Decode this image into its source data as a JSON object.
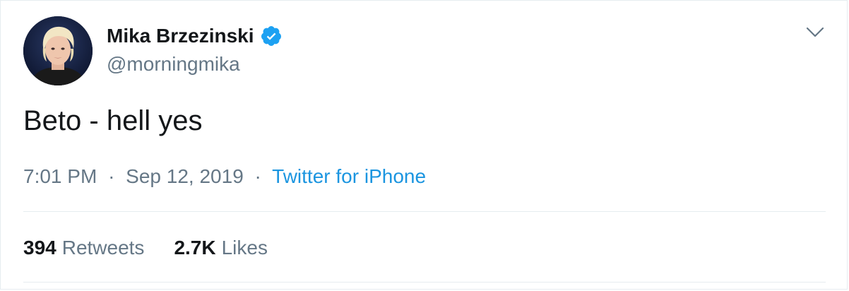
{
  "author": {
    "display_name": "Mika Brzezinski",
    "handle": "@morningmika",
    "verified_icon": "verified-badge-icon",
    "avatar_icon": "profile-photo"
  },
  "tweet": {
    "text": "Beto - hell yes",
    "time": "7:01 PM",
    "separator": "·",
    "date": "Sep 12, 2019",
    "source": "Twitter for iPhone"
  },
  "stats": {
    "retweets_count": "394",
    "retweets_label": "Retweets",
    "likes_count": "2.7K",
    "likes_label": "Likes"
  },
  "colors": {
    "primary_text": "#14171a",
    "secondary_text": "#657786",
    "link": "#1b95e0",
    "verified": "#1da1f2",
    "divider": "#e6ecf0"
  },
  "menu": {
    "icon": "chevron-down-icon"
  }
}
